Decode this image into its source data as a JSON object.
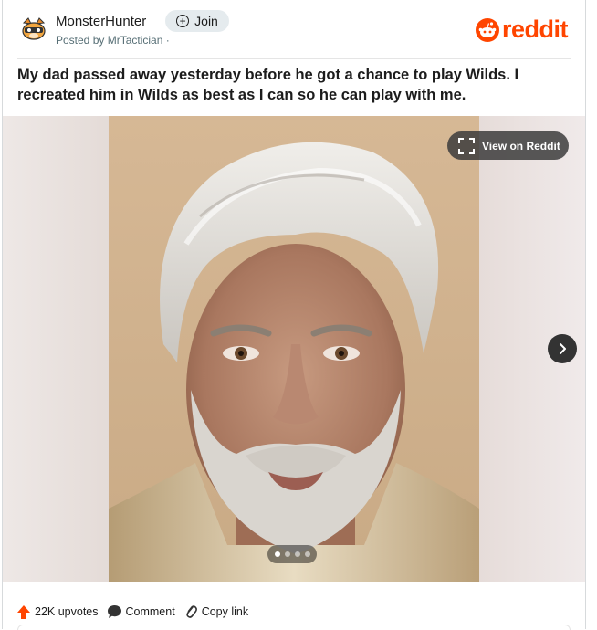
{
  "header": {
    "subreddit": "MonsterHunter",
    "posted_by": "Posted by MrTactician ·",
    "join_label": "Join",
    "brand": "reddit",
    "brand_color": "#ff4500"
  },
  "post": {
    "title": "My dad passed away yesterday before he got a chance to play Wilds. I recreated him in Wilds as best as I can so he can play with me."
  },
  "media": {
    "view_label": "View on Reddit",
    "carousel": {
      "total": 4,
      "active_index": 0
    }
  },
  "footer": {
    "upvotes": "22K upvotes",
    "comment": "Comment",
    "copy_link": "Copy link"
  },
  "icons": [
    "cat-avatar-icon",
    "plus-icon",
    "reddit-snoo-icon",
    "expand-icon",
    "chevron-right-icon",
    "upvote-arrow-icon",
    "comment-bubble-icon",
    "link-icon"
  ]
}
